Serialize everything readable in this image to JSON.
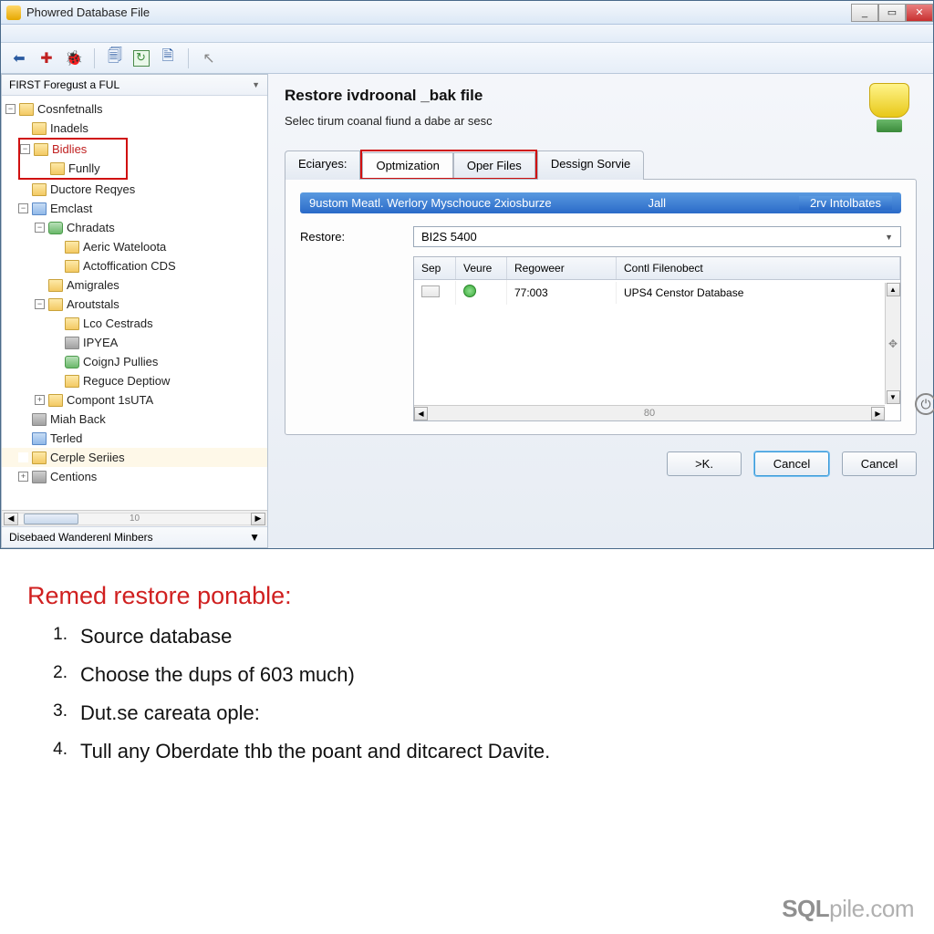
{
  "window": {
    "title": "Phowred Database File"
  },
  "sidebar": {
    "header": "FIRST Foregust a FUL",
    "footer": "Disebaed Wanderenl Minbers",
    "hscroll_mid": "10",
    "nodes": {
      "n0": "Cosnfetnalls",
      "n1": "Inadels",
      "n2": "Bidlies",
      "n3": "Funlly",
      "n4": "Ductore Reqyes",
      "n5": "Emclast",
      "n6": "Chradats",
      "n7": "Aeric Wateloota",
      "n8": "Actoffication CDS",
      "n9": "Amigrales",
      "n10": "Aroutstals",
      "n11": "Lco Cestrads",
      "n12": "IPYEA",
      "n13": "CoignJ Pullies",
      "n14": "Reguce Deptiow",
      "n15": "Compont 1sUTA",
      "n16": "Miah Back",
      "n17": "Terled",
      "n18": "Cerple Seriies",
      "n19": "Centions"
    }
  },
  "main": {
    "title": "Restore ivdroonal _bak file",
    "subtitle": "Selec tirum coanal fiund a dabe ar sesc",
    "tabs": {
      "t1": "Eciaryes:",
      "t2": "Optmization",
      "t3": "Oper Files",
      "t4": "Dessign Sorvie"
    },
    "bluebar": {
      "left": "9ustom Meatl. Werlory  Myschouce 2xiosburze",
      "mid": "Jall",
      "right": "2rv Intolbates"
    },
    "restore_label": "Restore:",
    "restore_value": "BI2S 5400",
    "grid": {
      "h1": "Sep",
      "h2": "Veure",
      "h3": "Regoweer",
      "h4": "Contl Filenobect",
      "r1c3": "77:003",
      "r1c4": "UPS4 Censtor Database",
      "hmid": "80"
    },
    "ok": ">K.",
    "cancel": "Cancel",
    "cancel2": "Cancel"
  },
  "notes": {
    "heading": "Remed restore ponable:",
    "i1": "Source database",
    "i2": "Choose the dups of 603 much)",
    "i3": "Dut.se careata ople:",
    "i4": "Tull any Oberdate thb the poant and ditcarect Davite."
  },
  "watermark": {
    "a": "SQL",
    "b": "pile",
    "c": ".com"
  }
}
